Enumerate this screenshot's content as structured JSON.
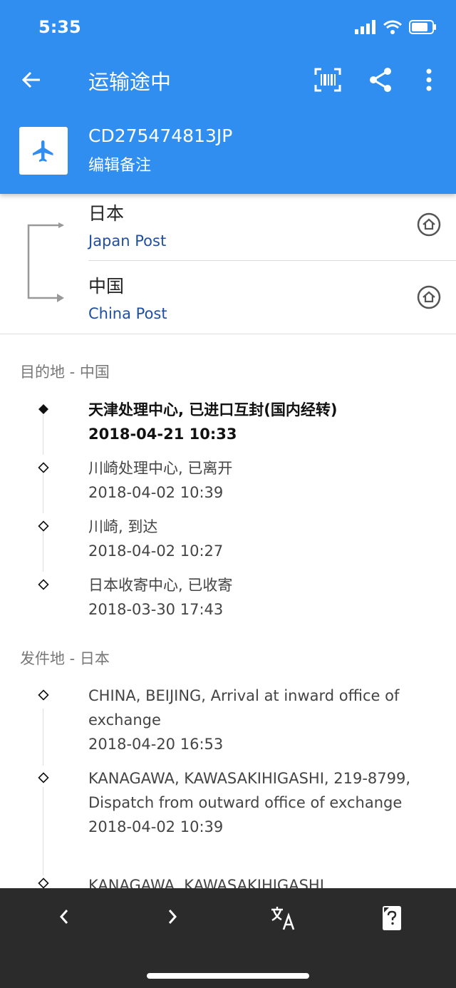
{
  "status_bar": {
    "time": "5:35"
  },
  "header": {
    "title": "运输途中",
    "tracking_number": "CD275474813JP",
    "note_label": "编辑备注"
  },
  "carriers": [
    {
      "country": "日本",
      "name": "Japan Post"
    },
    {
      "country": "中国",
      "name": "China Post"
    }
  ],
  "sections": [
    {
      "header": "目的地 - 中国",
      "events": [
        {
          "desc": "天津处理中心, 已进口互封(国内经转)",
          "time": "2018-04-21 10:33"
        },
        {
          "desc": "川崎处理中心, 已离开",
          "time": "2018-04-02 10:39"
        },
        {
          "desc": "川崎, 到达",
          "time": "2018-04-02 10:27"
        },
        {
          "desc": "日本收寄中心, 已收寄",
          "time": "2018-03-30 17:43"
        }
      ]
    },
    {
      "header": "发件地 - 日本",
      "events": [
        {
          "desc": "CHINA, BEIJING, Arrival at inward office of exchange",
          "time": "2018-04-20 16:53"
        },
        {
          "desc": "KANAGAWA, KAWASAKIHIGASHI, 219-8799, Dispatch from outward office of exchange",
          "time": "2018-04-02 10:39"
        },
        {
          "desc": "KANAGAWA, KAWASAKIHIGASHI,",
          "time": ""
        }
      ]
    }
  ],
  "colors": {
    "primary": "#2f8ef0",
    "link": "#1f4fa0",
    "bottom_bar": "#2b2b2b"
  }
}
